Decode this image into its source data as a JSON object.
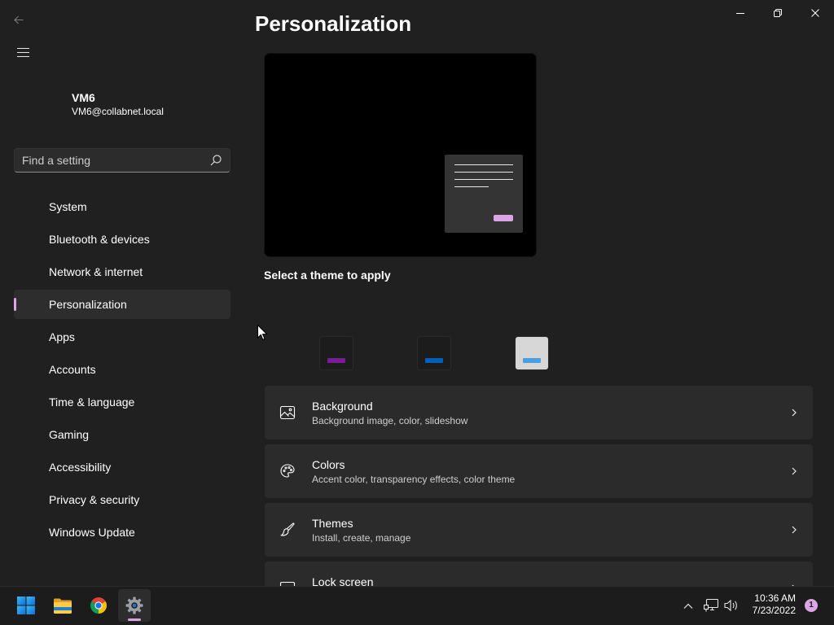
{
  "colors": {
    "window_bg": "#202020",
    "card_bg": "#2b2b2b",
    "selected_bg": "#2d2d2d",
    "accent": "#dba4e4",
    "taskbar_bg": "#1c1c1c"
  },
  "titlebar": {
    "back_icon": "back-arrow-icon",
    "menu_icon": "hamburger-menu-icon",
    "window_controls": [
      "minimize-icon",
      "restore-icon",
      "close-icon"
    ]
  },
  "user": {
    "name": "VM6",
    "email": "VM6@collabnet.local"
  },
  "search": {
    "placeholder": "Find a setting",
    "value": "",
    "icon": "search-icon"
  },
  "nav": {
    "items": [
      {
        "label": "System"
      },
      {
        "label": "Bluetooth & devices"
      },
      {
        "label": "Network & internet"
      },
      {
        "label": "Personalization",
        "selected": true
      },
      {
        "label": "Apps"
      },
      {
        "label": "Accounts"
      },
      {
        "label": "Time & language"
      },
      {
        "label": "Gaming"
      },
      {
        "label": "Accessibility"
      },
      {
        "label": "Privacy & security"
      },
      {
        "label": "Windows Update"
      }
    ]
  },
  "page": {
    "title": "Personalization",
    "preview": {
      "wallpaper_color": "#000000",
      "window_color": "#343434"
    },
    "themes": {
      "heading": "Select a theme to apply",
      "items": [
        {
          "background": "#1c1c1c",
          "accent": "#781c96"
        },
        {
          "background": "#1c1c1c",
          "accent": "#005fb8"
        },
        {
          "background": "#d7d7d7",
          "accent": "#4a9fe0"
        }
      ]
    },
    "cards": [
      {
        "title": "Background",
        "subtitle": "Background image, color, slideshow",
        "icon": "image-icon"
      },
      {
        "title": "Colors",
        "subtitle": "Accent color, transparency effects, color theme",
        "icon": "palette-icon"
      },
      {
        "title": "Themes",
        "subtitle": "Install, create, manage",
        "icon": "brush-icon"
      },
      {
        "title": "Lock screen",
        "icon": "lock-screen-icon"
      }
    ]
  },
  "cursor": {
    "icon": "mouse-pointer-icon"
  },
  "taskbar": {
    "apps": [
      {
        "icon": "windows-start-icon"
      },
      {
        "icon": "file-explorer-icon"
      },
      {
        "icon": "chrome-icon"
      },
      {
        "icon": "settings-gear-icon",
        "active": true
      }
    ],
    "tray": {
      "icons": [
        "show-hidden-icons-chevron-icon",
        "network-icon",
        "volume-icon"
      ],
      "time": "10:36 AM",
      "date": "7/23/2022",
      "notification_count": "1"
    }
  }
}
